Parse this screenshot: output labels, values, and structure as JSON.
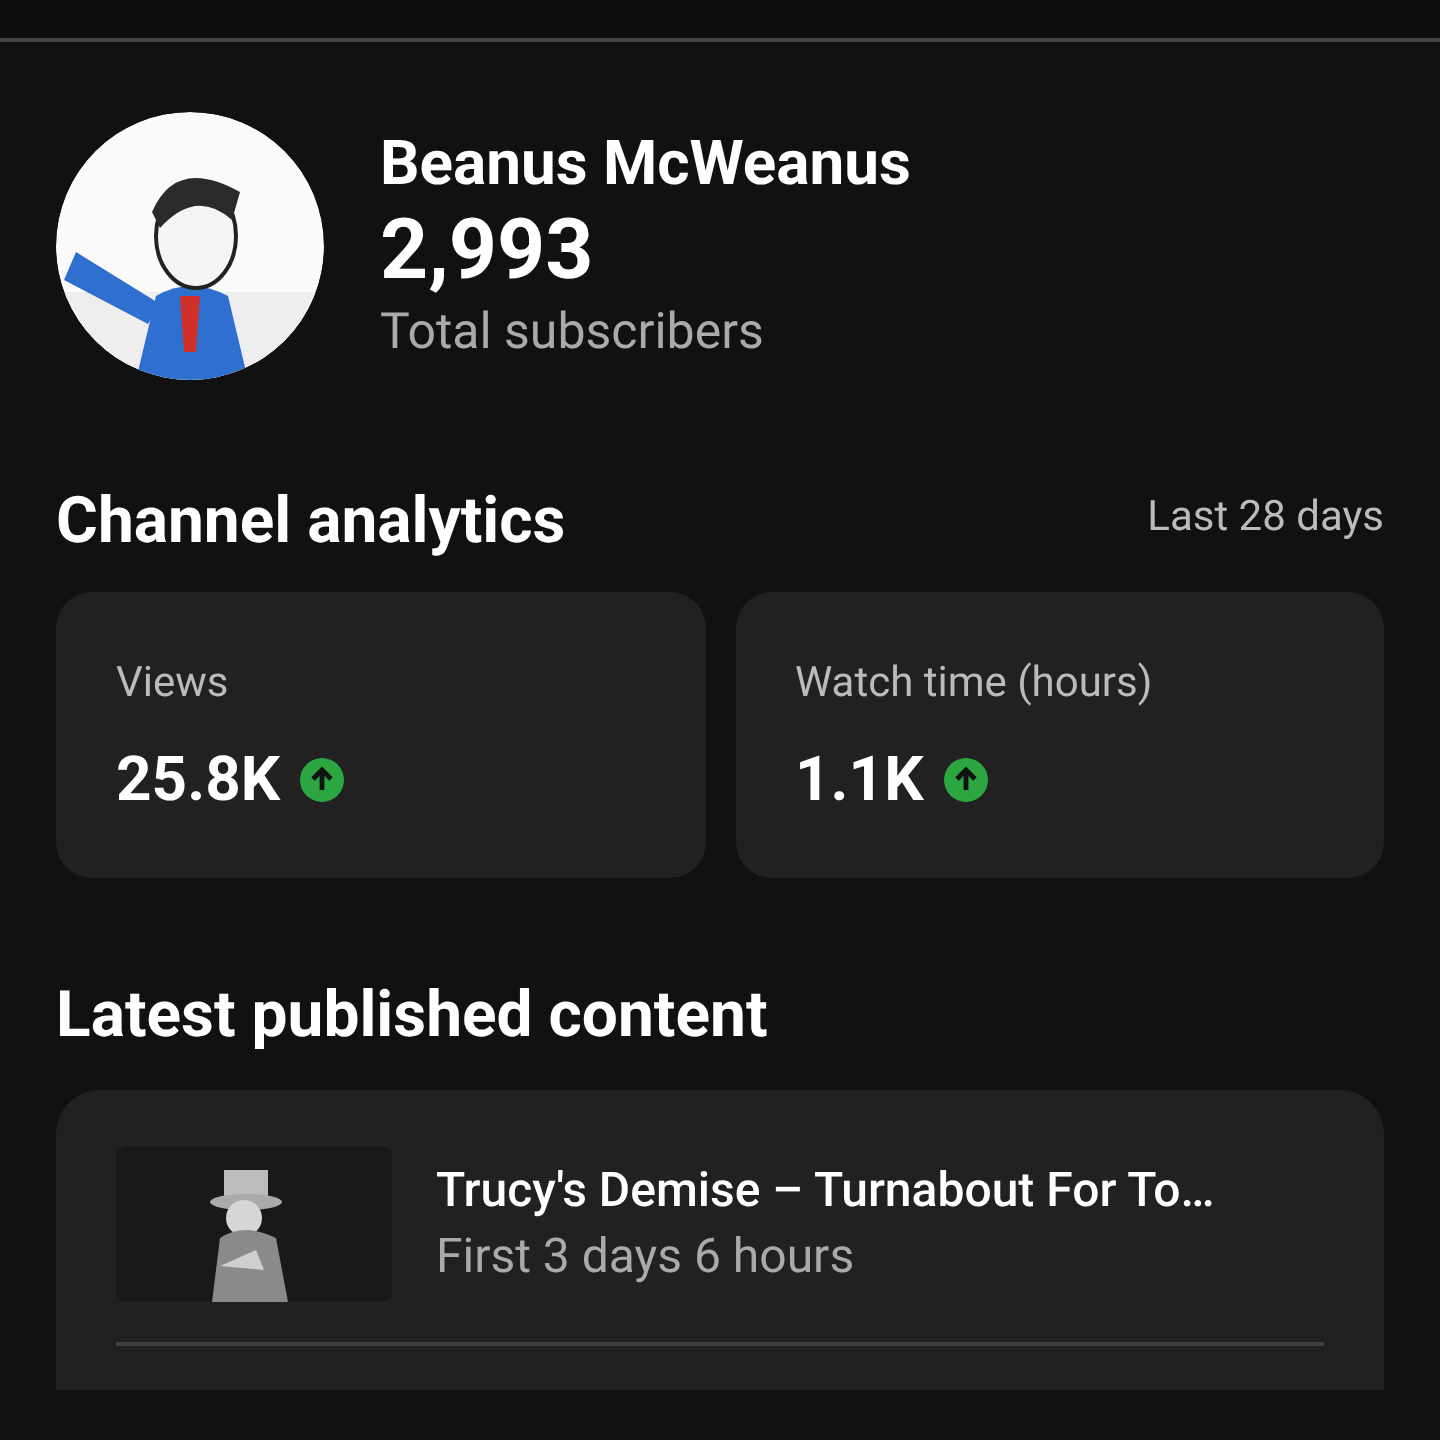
{
  "channel": {
    "name": "Beanus McWeanus",
    "subscribers": "2,993",
    "subscribers_label": "Total subscribers"
  },
  "analytics": {
    "title": "Channel analytics",
    "period": "Last 28 days",
    "metrics": [
      {
        "label": "Views",
        "value": "25.8K",
        "trending_up": true
      },
      {
        "label": "Watch time (hours)",
        "value": "1.1K",
        "trending_up": true
      }
    ]
  },
  "latest": {
    "title": "Latest published content",
    "video": {
      "title": "Trucy's Demise – Turnabout For To…",
      "stat": "First 3 days 6 hours"
    }
  }
}
